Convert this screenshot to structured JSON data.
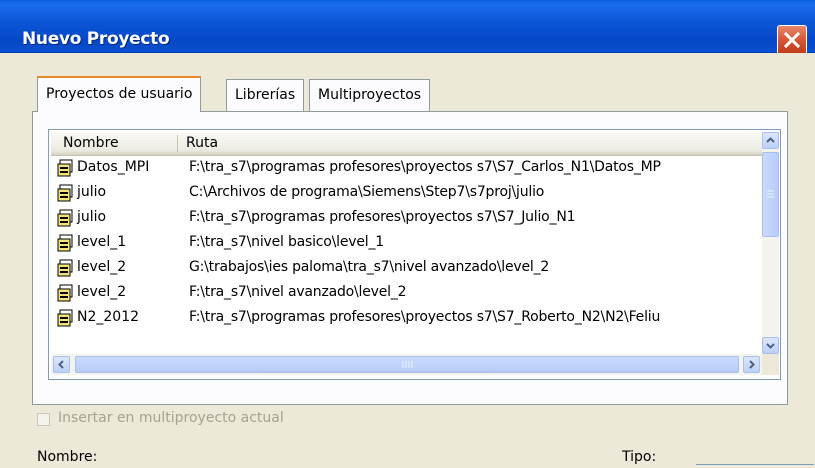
{
  "window": {
    "title": "Nuevo Proyecto",
    "close_icon": "close-icon"
  },
  "tabs": [
    {
      "label": "Proyectos de usuario",
      "active": true
    },
    {
      "label": "Librerías",
      "active": false
    },
    {
      "label": "Multiproyectos",
      "active": false
    }
  ],
  "list": {
    "columns": [
      "Nombre",
      "Ruta"
    ],
    "row_icon": "step7-project-icon",
    "rows": [
      {
        "name": "Datos_MPI",
        "path": "F:\\tra_s7\\programas profesores\\proyectos s7\\S7_Carlos_N1\\Datos_MP"
      },
      {
        "name": "julio",
        "path": "C:\\Archivos de programa\\Siemens\\Step7\\s7proj\\julio"
      },
      {
        "name": "julio",
        "path": "F:\\tra_s7\\programas profesores\\proyectos s7\\S7_Julio_N1"
      },
      {
        "name": "level_1",
        "path": "F:\\tra_s7\\nivel basico\\level_1"
      },
      {
        "name": "level_2",
        "path": "G:\\trabajos\\ies paloma\\tra_s7\\nivel avanzado\\level_2"
      },
      {
        "name": "level_2",
        "path": "F:\\tra_s7\\nivel avanzado\\level_2"
      },
      {
        "name": "N2_2012",
        "path": "F:\\tra_s7\\programas profesores\\proyectos s7\\S7_Roberto_N2\\N2\\Feliu"
      }
    ]
  },
  "checkbox": {
    "label": "Insertar en multiproyecto actual",
    "checked": false,
    "enabled": false
  },
  "fields": {
    "name_label": "Nombre:",
    "type_label": "Tipo:"
  },
  "colors": {
    "titlebar": "#0a55d6",
    "face": "#ece9d8",
    "close": "#c23a1a",
    "tab_highlight": "#e68b2c"
  }
}
